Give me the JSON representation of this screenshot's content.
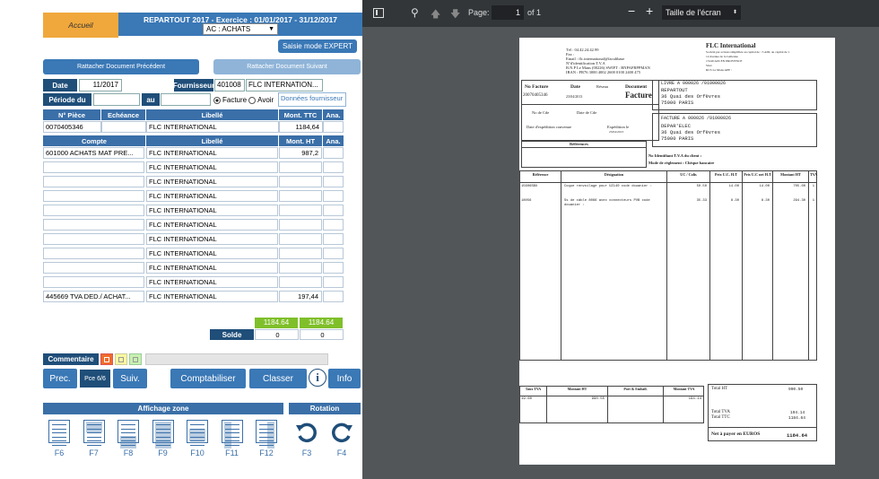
{
  "header": {
    "accueil": "Accueil",
    "title": "REPARTOUT 2017  - Exercice :  01/01/2017 - 31/12/2017",
    "journal": "AC : ACHATS",
    "saisie": "Saisie mode EXPERT"
  },
  "attach": {
    "prev": "Rattacher Document Précédent",
    "next": "Rattacher Document Suivant"
  },
  "form": {
    "date_lbl": "Date",
    "date_val": "11/2017",
    "fourn_lbl": "Fournisseur",
    "fourn_code": "401008",
    "fourn_name": "FLC INTERNATION...",
    "periode_lbl": "Période du",
    "au_lbl": "au",
    "facture": "Facture",
    "avoir": "Avoir",
    "donnees": "Données fournisseur"
  },
  "pieces": {
    "headers": [
      "N° Pièce",
      "Echéance",
      "Libellé",
      "Mont. TTC",
      "Ana."
    ],
    "row": [
      "0070405346",
      "",
      "FLC INTERNATIONAL",
      "1184,64",
      ""
    ]
  },
  "lines": {
    "headers": [
      "Compte",
      "Libellé",
      "Mont. HT",
      "Ana."
    ],
    "rows": [
      [
        "601000  ACHATS MAT PRE...",
        "FLC INTERNATIONAL",
        "987,2",
        ""
      ],
      [
        "",
        "FLC INTERNATIONAL",
        "",
        ""
      ],
      [
        "",
        "FLC INTERNATIONAL",
        "",
        ""
      ],
      [
        "",
        "FLC INTERNATIONAL",
        "",
        ""
      ],
      [
        "",
        "FLC INTERNATIONAL",
        "",
        ""
      ],
      [
        "",
        "FLC INTERNATIONAL",
        "",
        ""
      ],
      [
        "",
        "FLC INTERNATIONAL",
        "",
        ""
      ],
      [
        "",
        "FLC INTERNATIONAL",
        "",
        ""
      ],
      [
        "",
        "FLC INTERNATIONAL",
        "",
        ""
      ],
      [
        "",
        "FLC INTERNATIONAL",
        "",
        ""
      ],
      [
        "445669 TVA DED./ ACHAT...",
        "FLC INTERNATIONAL",
        "197,44",
        ""
      ]
    ]
  },
  "totals": {
    "debit": "1184.64",
    "credit": "1184.64",
    "solde_lbl": "Solde",
    "solde_d": "0",
    "solde_c": "0"
  },
  "bottom": {
    "commentaire": "Commentaire",
    "prec": "Prec.",
    "pce": "Pce 6/6",
    "suiv": "Suiv.",
    "comptabiliser": "Comptabiliser",
    "classer": "Classer",
    "info": "Info",
    "affichage": "Affichage zone",
    "rotation": "Rotation",
    "zones": [
      "F6",
      "F7",
      "F8",
      "F9",
      "F10",
      "F11",
      "F12"
    ],
    "rot": [
      "F3",
      "F4"
    ]
  },
  "viewer": {
    "page_lbl": "Page:",
    "page": "1",
    "of": "of 1",
    "zoom": "Taille de l'écran"
  },
  "invoice": {
    "company": "FLC International",
    "company_sub1": "Société par actions simplifiée au capital de :    5 ADI, au capital de 1",
    "company_sub2": "12 Avenue de la Gallenne",
    "company_sub3": "13140 AIX EN PROVENCE",
    "company_sub4": "Siret",
    "company_sub5": "RCS Le Mans                    APE :",
    "tel": "Tél :  04.42.24.42.99",
    "fax": "Fax :",
    "email": "Email :  flc.international@faculibase",
    "tva": "N°d'identification T.V.A",
    "bank": "B.N.P Le Mans (00226) SWIFT : BNPAFRPPMAN",
    "iban": "IBAN : FR76 3000 4002 2600 0100 2400 475",
    "nofacture_lbl": "No Facture",
    "date_lbl": "Date",
    "reseau": "Réseau",
    "document": "Document",
    "facture": "Facture",
    "nofacture": "20070405346",
    "date": "23/04/2013",
    "livre": "LIVRE A      000026      /01000026",
    "livre_name": "REPARTOUT",
    "livre_addr": "36 Quai des Orfèvres",
    "livre_city": "75000  PARIS",
    "fact": "FACTURE A    000026      /01000026",
    "fact_name": "DEPAR'ELEC",
    "fact_addr": "36 Quai des Orfèvres",
    "fact_city": "75000  PARIS",
    "no_cde": "No de Cde",
    "date_cde": "Date de Cde",
    "date_exp": "Date d'expédition convenue",
    "expedition": "Expédition le",
    "exp_date": "23/04/2013",
    "references": "Références",
    "tva_client": "No Identifiant T.V.A du client :",
    "reglement": "Mode de règlement : Chèque bancaire",
    "cols": [
      "Référence",
      "Désignation",
      "UC / Colis",
      "Prix U.C. H.T",
      "Prix U.C net H.T",
      "Montant HT",
      "TVA"
    ],
    "items": [
      [
        "15606SBU",
        "Coque renvoilage pour UZ140 code douanier :",
        "50.50",
        "14.00",
        "14.00",
        "705.00",
        "1"
      ],
      [
        "18056",
        "Ss de câble 8066 avec connecteurs PVB code douanier :",
        "35.33",
        "8.30",
        "8.30",
        "294.30",
        "1"
      ]
    ],
    "tva_cols": [
      "Taux TVA",
      "Montant HT",
      "Port & Emball.",
      "Montant TVA"
    ],
    "tva_row": [
      "19.60",
      "990.55",
      "",
      "194.14"
    ],
    "total_ht_lbl": "Total HT",
    "total_ht": "990.50",
    "total_tva_lbl": "Total TVA",
    "total_tva": "194.14",
    "total_ttc_lbl": "Total TTC",
    "total_ttc": "1184.64",
    "net_lbl": "Net à payer     en EUROS",
    "net": "1184.64"
  }
}
